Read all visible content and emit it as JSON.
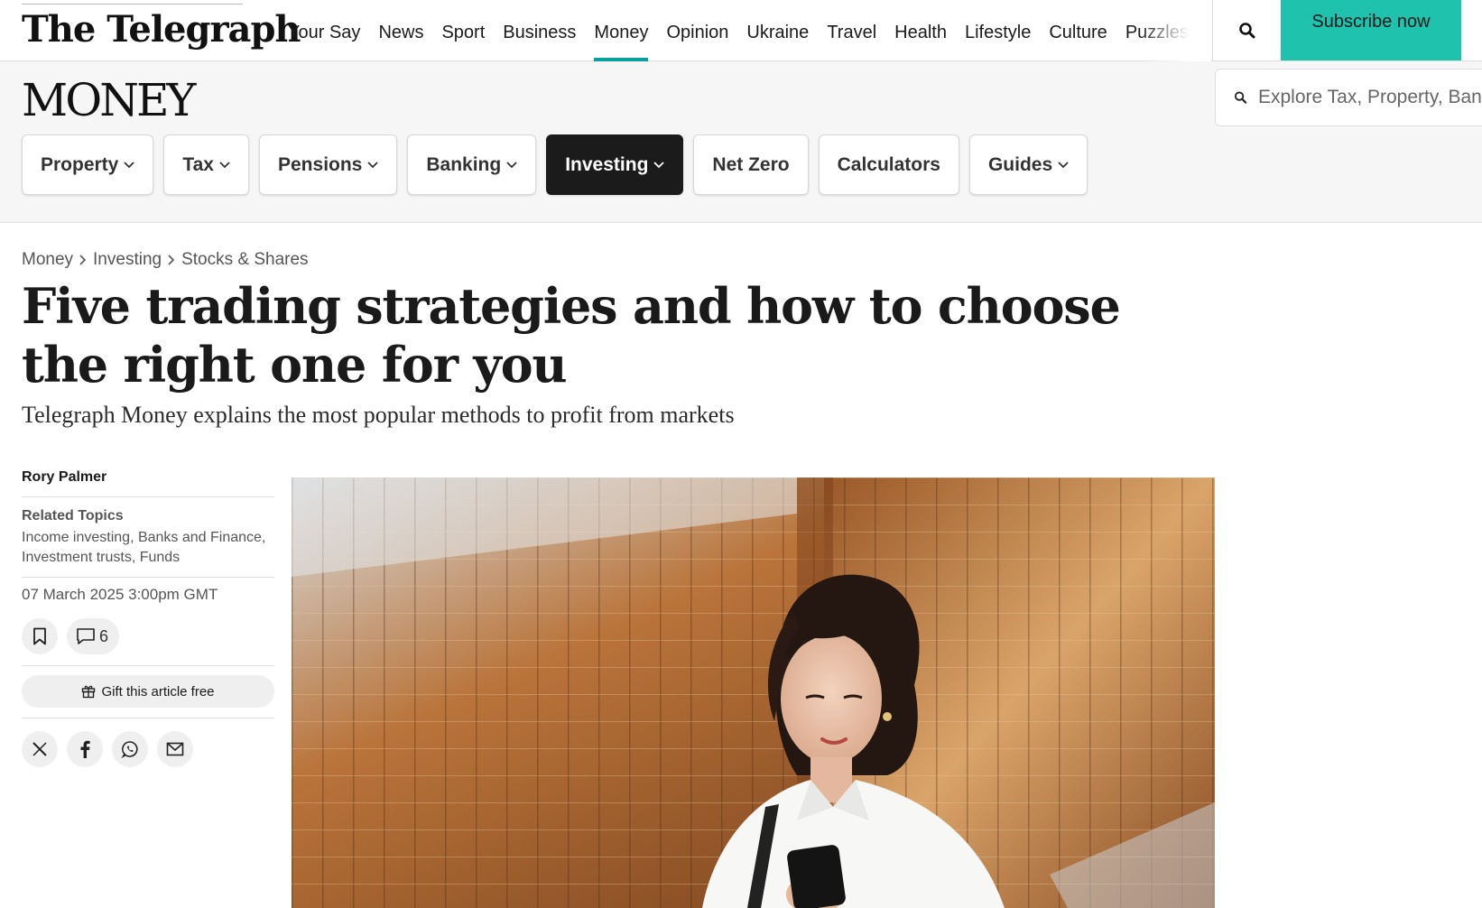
{
  "header": {
    "logo": "The Telegraph",
    "nav": [
      {
        "label": "Your Say",
        "active": false
      },
      {
        "label": "News",
        "active": false
      },
      {
        "label": "Sport",
        "active": false
      },
      {
        "label": "Business",
        "active": false
      },
      {
        "label": "Money",
        "active": true
      },
      {
        "label": "Opinion",
        "active": false
      },
      {
        "label": "Ukraine",
        "active": false
      },
      {
        "label": "Travel",
        "active": false
      },
      {
        "label": "Health",
        "active": false
      },
      {
        "label": "Lifestyle",
        "active": false
      },
      {
        "label": "Culture",
        "active": false
      },
      {
        "label": "Puzzles",
        "active": false
      }
    ],
    "search_icon": "search-icon",
    "subscribe_label": "Subscribe now",
    "accent_color": "#1ec2ad"
  },
  "section": {
    "title": "MONEY",
    "search_placeholder": "Explore Tax, Property, Banking",
    "subnav": [
      {
        "label": "Property",
        "dropdown": true,
        "active": false
      },
      {
        "label": "Tax",
        "dropdown": true,
        "active": false
      },
      {
        "label": "Pensions",
        "dropdown": true,
        "active": false
      },
      {
        "label": "Banking",
        "dropdown": true,
        "active": false
      },
      {
        "label": "Investing",
        "dropdown": true,
        "active": true
      },
      {
        "label": "Net Zero",
        "dropdown": false,
        "active": false
      },
      {
        "label": "Calculators",
        "dropdown": false,
        "active": false
      },
      {
        "label": "Guides",
        "dropdown": true,
        "active": false
      }
    ]
  },
  "article": {
    "breadcrumb": [
      "Money",
      "Investing",
      "Stocks & Shares"
    ],
    "headline": "Five trading strategies and how to choose the right one for you",
    "standfirst": "Telegraph Money explains the most popular methods to profit from markets",
    "author": "Rory Palmer",
    "related_label": "Related Topics",
    "related_topics": "Income investing, Banks and Finance, Investment trusts, Funds",
    "date": "07 March 2025 3:00pm GMT",
    "comment_count": "6",
    "gift_label": "Gift this article free",
    "share_icons": [
      "x-icon",
      "facebook-icon",
      "whatsapp-icon",
      "email-icon"
    ]
  }
}
